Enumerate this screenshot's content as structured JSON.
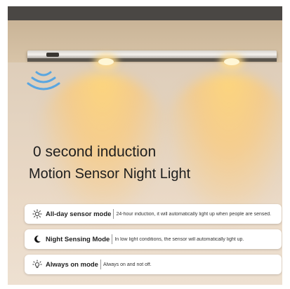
{
  "headline": {
    "line1": "0 second induction",
    "line2": "Motion Sensor Night Light"
  },
  "modes": [
    {
      "icon": "sun-icon",
      "name": "All-day sensor mode",
      "description": "24-hour induction, it will automatically light up when people are sensed."
    },
    {
      "icon": "moon-icon",
      "name": "Night Sensing Mode",
      "description": "In  low light conditions, the sensor will automatically light up."
    },
    {
      "icon": "light-icon",
      "name": "Always on mode",
      "description": "Always on and not off."
    }
  ],
  "colors": {
    "wave_icon": "#5aa6e0",
    "light_glow": "#ffd37a",
    "text": "#1e1e1e"
  }
}
